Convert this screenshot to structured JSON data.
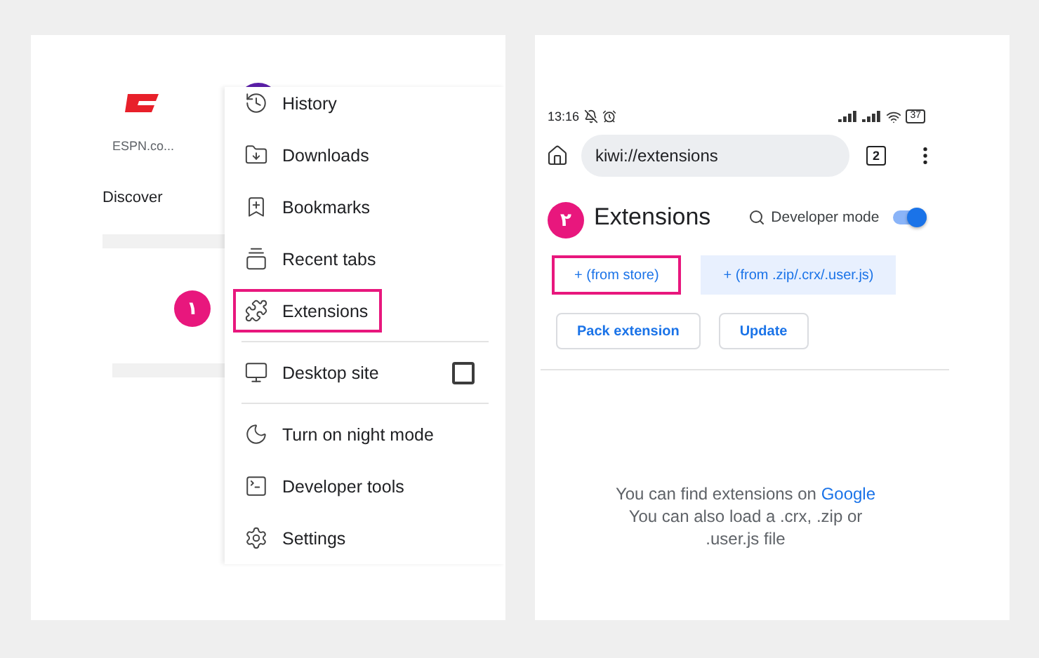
{
  "left_screen": {
    "shortcuts": [
      {
        "label": "ESPN.co...",
        "color": "#e8202a"
      },
      {
        "color": "#5b1fa8"
      }
    ],
    "section_title": "Discover",
    "step_badge": "١",
    "menu": {
      "groups": [
        [
          {
            "label": "History",
            "kind": "item",
            "highlighted": false
          },
          {
            "label": "Downloads",
            "kind": "item",
            "highlighted": false
          },
          {
            "label": "Bookmarks",
            "kind": "item",
            "highlighted": false
          },
          {
            "label": "Recent tabs",
            "kind": "item",
            "highlighted": false
          },
          {
            "label": "Extensions",
            "kind": "item",
            "highlighted": true
          }
        ],
        [
          {
            "label": "Desktop site",
            "kind": "checkbox",
            "checked": false,
            "highlighted": false
          }
        ],
        [
          {
            "label": "Turn on night mode",
            "kind": "item",
            "highlighted": false
          },
          {
            "label": "Developer tools",
            "kind": "item",
            "highlighted": false
          },
          {
            "label": "Settings",
            "kind": "item",
            "highlighted": false
          }
        ]
      ]
    }
  },
  "right_screen": {
    "status_bar": {
      "time": "13:16",
      "battery": "37"
    },
    "address_bar": {
      "url": "kiwi://extensions",
      "tab_count": "2"
    },
    "step_badge": "٢",
    "title": "Extensions",
    "developer_mode": {
      "label": "Developer mode",
      "on": true
    },
    "load_buttons": [
      {
        "label": "+ (from store)",
        "highlighted": true
      },
      {
        "label": "+ (from .zip/.crx/.user.js)",
        "highlighted": false
      }
    ],
    "action_buttons": [
      "Pack extension",
      "Update"
    ],
    "empty_message": {
      "text": "You can find extensions on",
      "link": "Google",
      "note": "You can also load a .crx, .zip or .user.js file"
    }
  }
}
